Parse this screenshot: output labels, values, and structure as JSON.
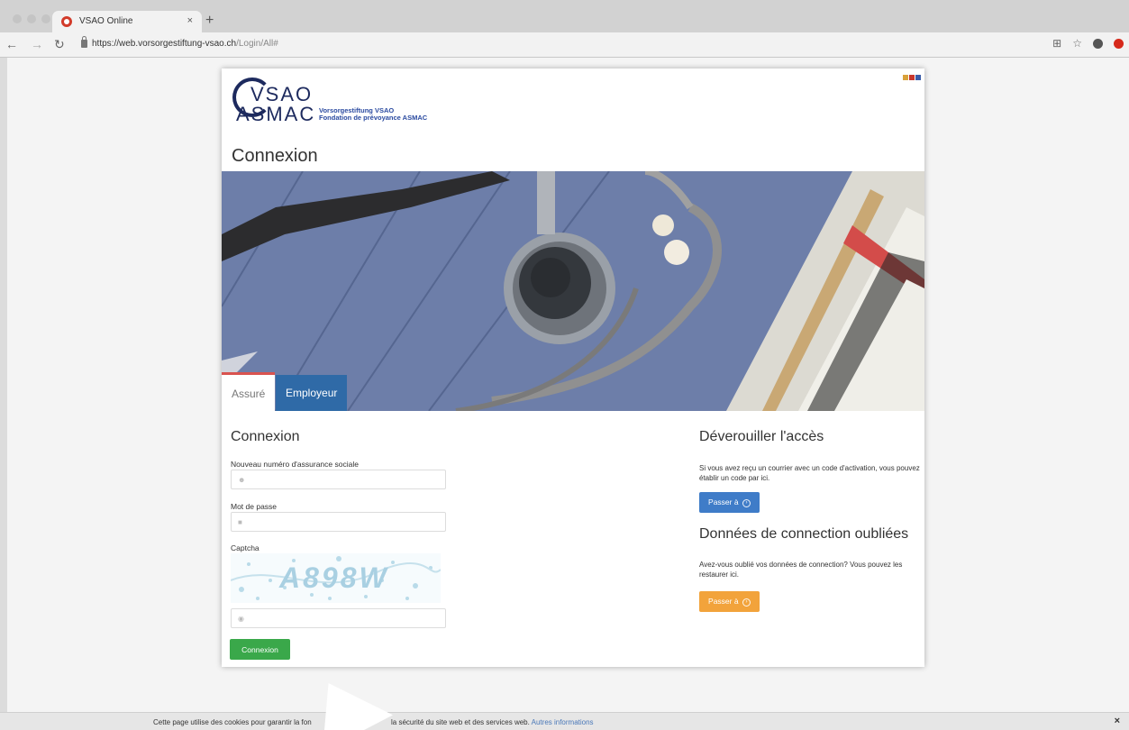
{
  "browser": {
    "tab_title": "VSAO Online",
    "tab_close": "×",
    "new_tab": "+",
    "url_host": "https://web.vorsorgestiftung-vsao.ch",
    "url_path": "/Login/All#"
  },
  "logo": {
    "line_vsao": "VSAO",
    "line_asmac": "ASMAC",
    "tagline_de": "Vorsorgestiftung VSAO",
    "tagline_fr": "Fondation de prévoyance ASMAC"
  },
  "page": {
    "title": "Connexion"
  },
  "tabs": [
    {
      "label": "Assuré"
    },
    {
      "label": "Employeur"
    }
  ],
  "login": {
    "heading": "Connexion",
    "ssn_label": "Nouveau numéro d'assurance sociale",
    "password_label": "Mot de passe",
    "captcha_label": "Captcha",
    "captcha_text": "A898W",
    "submit": "Connexion"
  },
  "unlock": {
    "heading": "Déverouiller l'accès",
    "text": "Si vous avez reçu un courrier avec un code d'activation, vous pouvez établir un code par ici.",
    "button": "Passer à"
  },
  "forgot": {
    "heading": "Données de connection oubliées",
    "text": "Avez-vous oublié vos données de connection? Vous pouvez les restaurer ici.",
    "button": "Passer à"
  },
  "cookie": {
    "text_start": "Cette page utilise des cookies pour garantir la fon",
    "text_end": "la sécurité du site web et des services web.",
    "link": "Autres informations",
    "close": "×"
  },
  "colors": {
    "brand_navy": "#1d2a5e",
    "tab_active_border": "#d9534f",
    "tab_employeur": "#2f6aa7",
    "btn_login": "#3aa84a",
    "btn_unlock": "#3f7cc8",
    "btn_forgot": "#f2a33b"
  }
}
